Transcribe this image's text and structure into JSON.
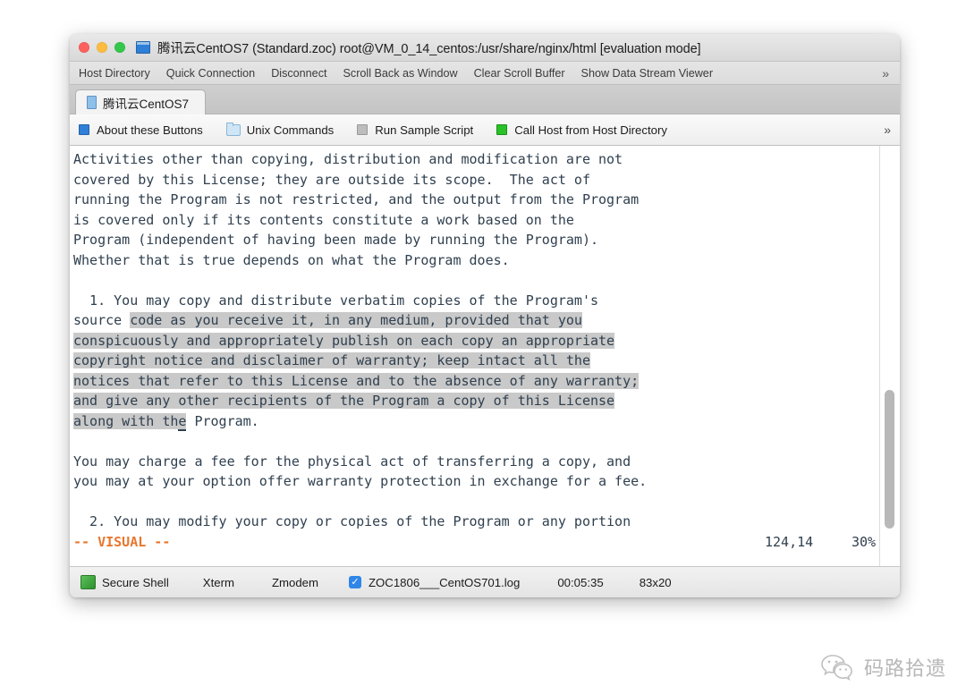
{
  "window": {
    "title": "腾讯云CentOS7 (Standard.zoc) root@VM_0_14_centos:/usr/share/nginx/html [evaluation mode]",
    "traffic_lights": {
      "close": "close-button",
      "minimize": "minimize-button",
      "zoom": "zoom-button"
    },
    "colors": {
      "close": "#fc615d",
      "minimize": "#fdbc40",
      "zoom": "#34c749",
      "accent_blue": "#2f86e8",
      "vim_visual_orange": "#e8772e",
      "terminal_text": "#30404f",
      "selection_gray": "#c9c9c9"
    }
  },
  "menubar": {
    "items": [
      {
        "label": "Host Directory"
      },
      {
        "label": "Quick Connection"
      },
      {
        "label": "Disconnect"
      },
      {
        "label": "Scroll Back as Window"
      },
      {
        "label": "Clear Scroll Buffer"
      },
      {
        "label": "Show Data Stream Viewer"
      }
    ],
    "overflow": "»"
  },
  "tabs": [
    {
      "label": "腾讯云CentOS7",
      "active": true
    }
  ],
  "buttonbar": {
    "buttons": [
      {
        "label": "About these Buttons",
        "icon": "blue-square-icon"
      },
      {
        "label": "Unix Commands",
        "icon": "folder-icon"
      },
      {
        "label": "Run Sample Script",
        "icon": "gray-square-icon"
      },
      {
        "label": "Call Host from Host Directory",
        "icon": "green-square-icon"
      }
    ],
    "overflow": "»"
  },
  "terminal": {
    "lines": [
      [
        {
          "t": "Activities other than copying, distribution and modification are not",
          "h": false
        }
      ],
      [
        {
          "t": "covered by this License; they are outside its scope.  The act of",
          "h": false
        }
      ],
      [
        {
          "t": "running the Program is not restricted, and the output from the Program",
          "h": false
        }
      ],
      [
        {
          "t": "is covered only if its contents constitute a work based on the",
          "h": false
        }
      ],
      [
        {
          "t": "Program (independent of having been made by running the Program).",
          "h": false
        }
      ],
      [
        {
          "t": "Whether that is true depends on what the Program does.",
          "h": false
        }
      ],
      [
        {
          "t": "",
          "h": false
        }
      ],
      [
        {
          "t": "  1. You may copy and distribute verbatim copies of the Program's",
          "h": false
        }
      ],
      [
        {
          "t": "source ",
          "h": false
        },
        {
          "t": "code as you receive it, in any medium, provided that you",
          "h": true
        }
      ],
      [
        {
          "t": "conspicuously and appropriately publish on each copy an appropriate",
          "h": true
        }
      ],
      [
        {
          "t": "copyright notice and disclaimer of warranty; keep intact all the",
          "h": true
        }
      ],
      [
        {
          "t": "notices that refer to this License and to the absence of any warranty;",
          "h": true
        }
      ],
      [
        {
          "t": "and give any other recipients of the Program a copy of this License",
          "h": true
        }
      ],
      [
        {
          "t": "along with th",
          "h": true
        },
        {
          "t": "e",
          "h": true,
          "c": true
        },
        {
          "t": " Program.",
          "h": false
        }
      ],
      [
        {
          "t": "",
          "h": false
        }
      ],
      [
        {
          "t": "You may charge a fee for the physical act of transferring a copy, and",
          "h": false
        }
      ],
      [
        {
          "t": "you may at your option offer warranty protection in exchange for a fee.",
          "h": false
        }
      ],
      [
        {
          "t": "",
          "h": false
        }
      ],
      [
        {
          "t": "  2. You may modify your copy or copies of the Program or any portion",
          "h": false
        }
      ]
    ],
    "statusline": {
      "mode": "-- VISUAL --",
      "position": "124,14",
      "percent": "30%"
    },
    "scrollbar": {
      "thumb_top_pct": 58,
      "thumb_height_pct": 33
    }
  },
  "statusbar": {
    "shell": "Secure Shell",
    "emulation": "Xterm",
    "transfer": "Zmodem",
    "log_checked": "✓",
    "log_file": "ZOC1806___CentOS701.log",
    "elapsed": "00:05:35",
    "size": "83x20"
  },
  "watermark": {
    "text": "码路拾遗",
    "icon": "wechat-icon"
  }
}
